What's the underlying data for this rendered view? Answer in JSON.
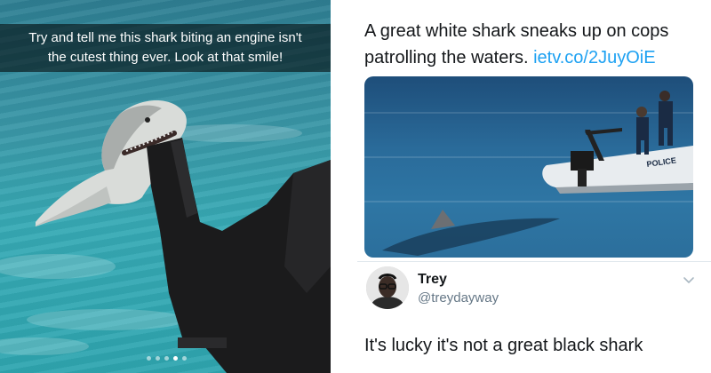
{
  "left_panel": {
    "caption_line1": "Try and tell me this shark biting an engine isn't",
    "caption_line2": "the cutest thing ever. Look at that smile!",
    "page_dots": 5,
    "active_dot": 4
  },
  "tweet": {
    "text": "A great white shark sneaks up on cops patrolling the waters.",
    "link": "ietv.co/2JuyOiE",
    "image_labels": {
      "boat_text": "POLICE"
    }
  },
  "reply": {
    "name": "Trey",
    "handle": "@treydayway",
    "text": "It's lucky it's not a great black shark"
  },
  "colors": {
    "link": "#1da1f2",
    "text": "#14171a",
    "secondary": "#657786",
    "water": "#37aab5"
  },
  "icons": [
    "chevron-down-icon"
  ]
}
